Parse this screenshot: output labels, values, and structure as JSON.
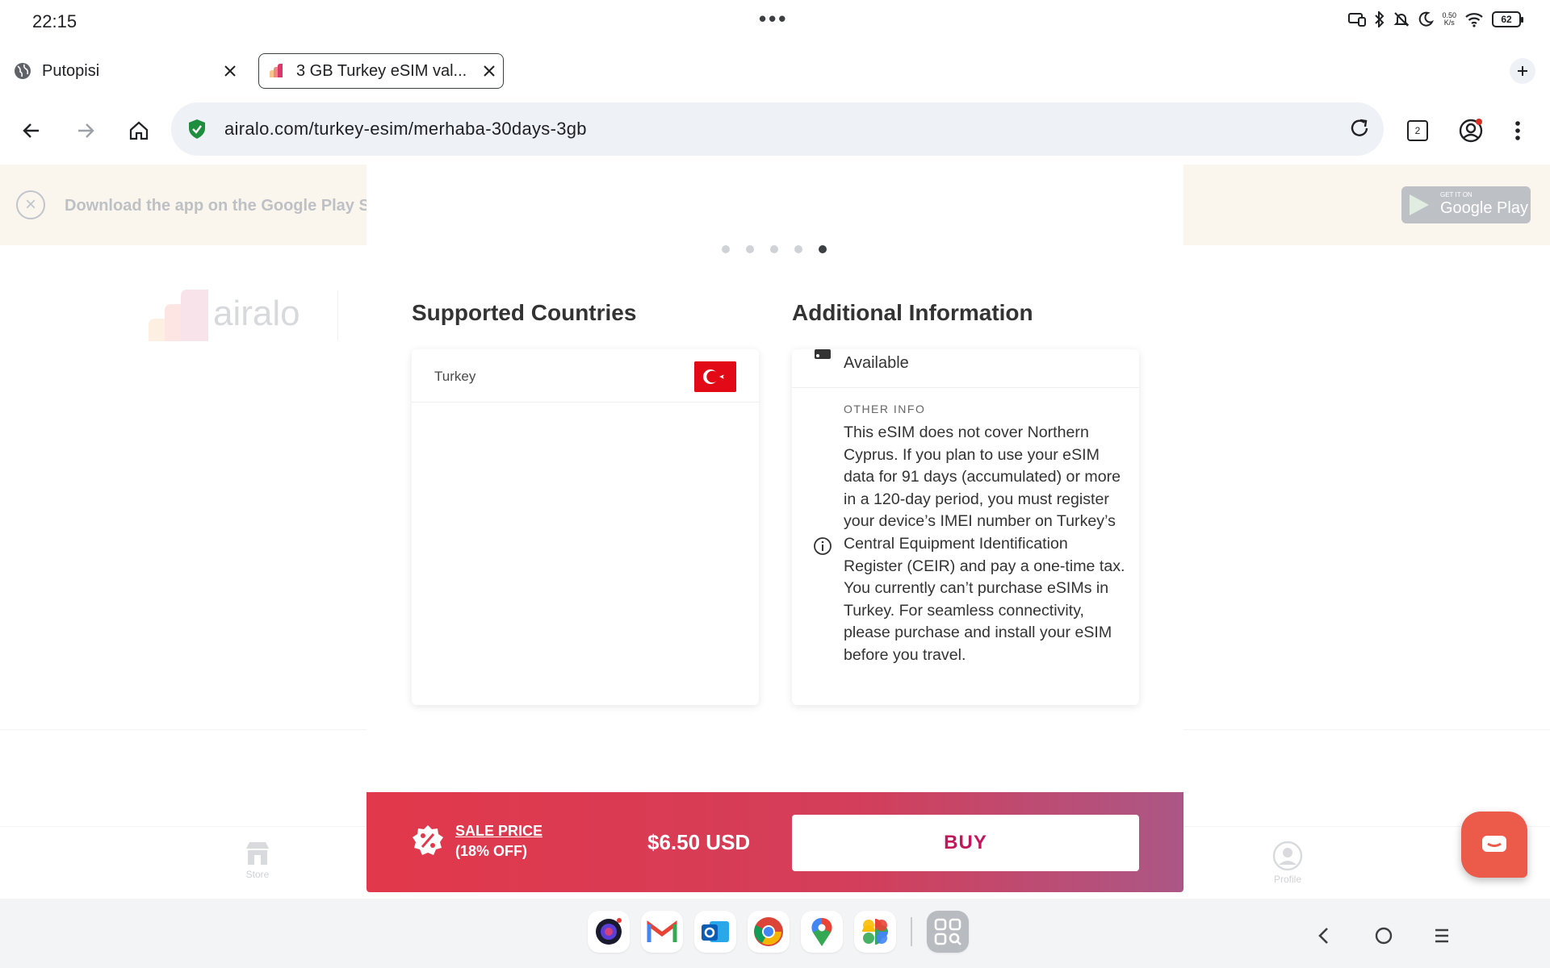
{
  "status_bar": {
    "time": "22:15",
    "net_speed_value": "0.50",
    "net_speed_unit": "K/s",
    "battery": "62"
  },
  "tabs": [
    {
      "label": "Putopisi",
      "active": false
    },
    {
      "label": "3 GB Turkey eSIM val...",
      "active": true
    }
  ],
  "toolbar": {
    "url": "airalo.com/turkey-esim/merhaba-30days-3gb",
    "tab_count": "2"
  },
  "banner": {
    "text": "Download the app on the Google Play S",
    "store_small": "GET IT ON",
    "store_big": "Google Play"
  },
  "background": {
    "logo_text": "airalo",
    "nav_store": "Store",
    "nav_profile": "Profile"
  },
  "modal": {
    "carousel": {
      "count": 5,
      "active_index": 4
    },
    "supported_countries": {
      "title": "Supported Countries",
      "countries": [
        {
          "name": "Turkey",
          "flag": "turkey-flag"
        }
      ]
    },
    "additional_info": {
      "title": "Additional Information",
      "availability": "Available",
      "other_info_label": "OTHER INFO",
      "other_info_text": "This eSIM does not cover Northern Cyprus. If you plan to use your eSIM data for 91 days (accumulated) or more in a 120-day period, you must register your device’s IMEI number on Turkey’s Central Equipment Identification Register (CEIR) and pay a one-time tax. You currently can’t purchase eSIMs in Turkey. For seamless connectivity, please purchase and install your eSIM before you travel."
    },
    "buy_bar": {
      "sale_label": "SALE PRICE",
      "discount": "(18% OFF)",
      "price": "$6.50 USD",
      "buy_label": "BUY"
    }
  },
  "colors": {
    "buy_gradient_start": "#e2384b",
    "buy_gradient_end": "#ab5786",
    "buy_text": "#c2185b",
    "chat_fab": "#ec5a4a"
  }
}
